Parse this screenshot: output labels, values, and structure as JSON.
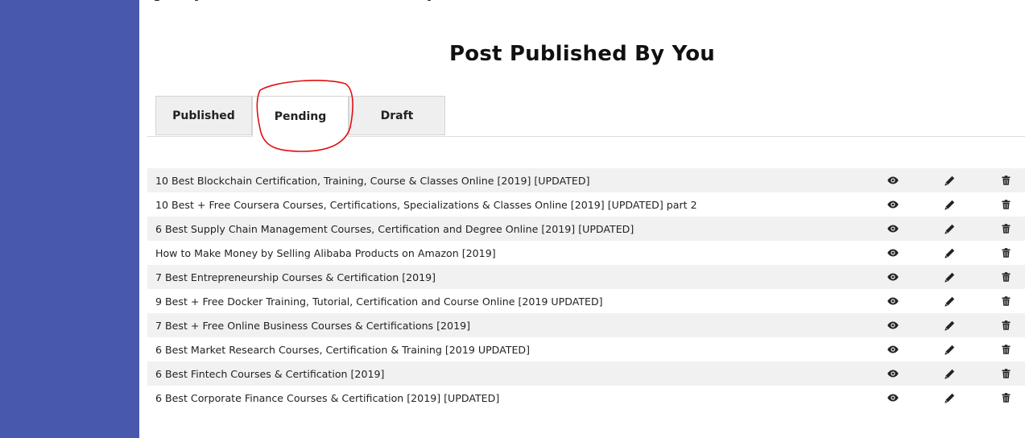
{
  "page": {
    "title": "Post Published By You"
  },
  "tabs": [
    {
      "label": "Published",
      "active": false
    },
    {
      "label": "Pending",
      "active": true
    },
    {
      "label": "Draft",
      "active": false
    }
  ],
  "posts": [
    {
      "title": "10 Best Blockchain Certification, Training, Course & Classes Online [2019] [UPDATED]"
    },
    {
      "title": "10 Best + Free Coursera Courses, Certifications, Specializations & Classes Online [2019] [UPDATED] part 2"
    },
    {
      "title": "6 Best Supply Chain Management Courses, Certification and Degree Online [2019] [UPDATED]"
    },
    {
      "title": "How to Make Money by Selling Alibaba Products on Amazon [2019]"
    },
    {
      "title": "7 Best Entrepreneurship Courses & Certification [2019]"
    },
    {
      "title": "9 Best + Free Docker Training, Tutorial, Certification and Course Online [2019 UPDATED]"
    },
    {
      "title": "7 Best + Free Online Business Courses & Certifications [2019]"
    },
    {
      "title": "6 Best Market Research Courses, Certification & Training [2019 UPDATED]"
    },
    {
      "title": "6 Best Fintech Courses & Certification [2019]"
    },
    {
      "title": "6 Best Corporate Finance Courses & Certification [2019] [UPDATED]"
    }
  ],
  "icons": {
    "view": "eye-icon",
    "edit": "pencil-icon",
    "delete": "trash-icon"
  },
  "colors": {
    "sidebar": "#4758ad",
    "annotation": "#e01010",
    "row_alt": "#f1f1f1"
  }
}
